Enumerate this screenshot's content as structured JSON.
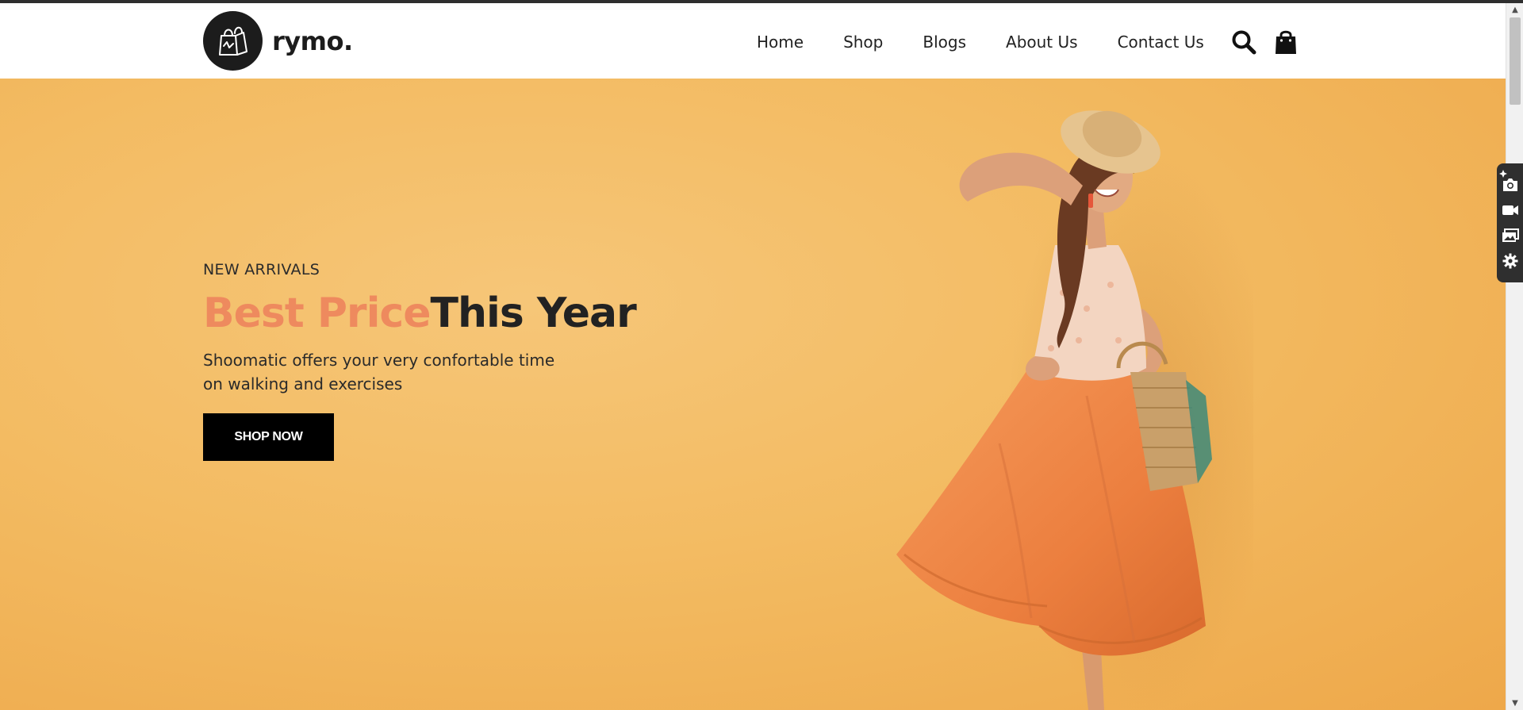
{
  "brand": {
    "name": "rymo."
  },
  "nav": {
    "items": [
      {
        "label": "Home"
      },
      {
        "label": "Shop"
      },
      {
        "label": "Blogs"
      },
      {
        "label": "About Us"
      },
      {
        "label": "Contact Us"
      }
    ],
    "search_icon": "search-icon",
    "cart_icon": "shopping-bag-icon"
  },
  "hero": {
    "eyebrow": "NEW ARRIVALS",
    "headline_accent": "Best Price",
    "headline_rest": "This Year",
    "subtext": "Shoomatic offers your very confortable time on walking and exercises",
    "cta_label": "SHOP NOW",
    "image": "woman-in-orange-dress-with-straw-hat-and-basket",
    "colors": {
      "background": "#f3bb62",
      "accent": "#ee8a5e",
      "headline": "#222222",
      "button": "#000000"
    }
  },
  "capture_toolbar": {
    "icons": [
      "pin-icon",
      "camera-icon",
      "video-icon",
      "gallery-icon",
      "gear-icon"
    ]
  }
}
